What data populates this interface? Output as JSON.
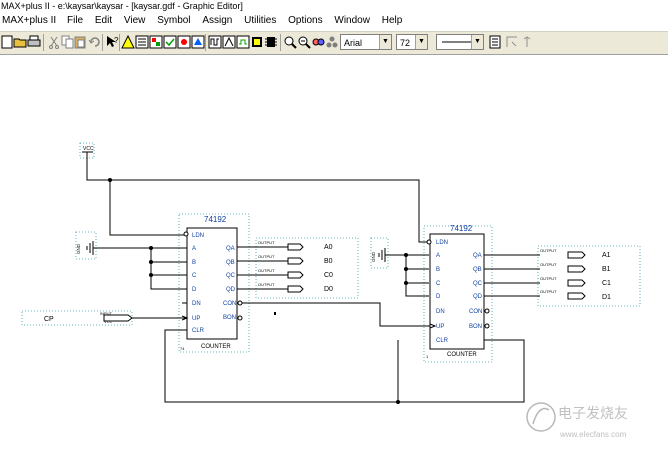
{
  "window": {
    "title": "MAX+plus II - e:\\kaysar\\kaysar - [kaysar.gdf - Graphic Editor]"
  },
  "menu": {
    "items": [
      "MAX+plus II",
      "File",
      "Edit",
      "View",
      "Symbol",
      "Assign",
      "Utilities",
      "Options",
      "Window",
      "Help"
    ]
  },
  "toolbar": {
    "font_name": "Arial",
    "font_size": "72",
    "dropdown_arrow": "▼"
  },
  "schematic": {
    "vcc_label": "VCC",
    "gnd_label": "GND",
    "chip1": {
      "part": "74192",
      "footer": "COUNTER",
      "corner": "74",
      "pins_left": [
        "LDN",
        "A",
        "B",
        "C",
        "D",
        "DN",
        "UP",
        "CLR"
      ],
      "pins_right": [
        "QA",
        "QB",
        "QC",
        "QD",
        "CON",
        "BON"
      ]
    },
    "chip2": {
      "part": "74192",
      "footer": "COUNTER",
      "corner": "1",
      "pins_left": [
        "LDN",
        "A",
        "B",
        "C",
        "D",
        "DN",
        "UP",
        "CLR"
      ],
      "pins_right": [
        "QA",
        "QB",
        "QC",
        "QD",
        "CON",
        "BON"
      ]
    },
    "input": {
      "name": "CP",
      "symbol_label": "INPUT",
      "vcc_tag": "VCC"
    },
    "outputs1": {
      "symbol_label": "OUTPUT",
      "names": [
        "A0",
        "B0",
        "C0",
        "D0"
      ]
    },
    "outputs2": {
      "symbol_label": "OUTPUT",
      "names": [
        "A1",
        "B1",
        "C1",
        "D1"
      ]
    }
  },
  "watermark": {
    "cn": "电子发烧友",
    "url": "www.elecfans.com"
  }
}
